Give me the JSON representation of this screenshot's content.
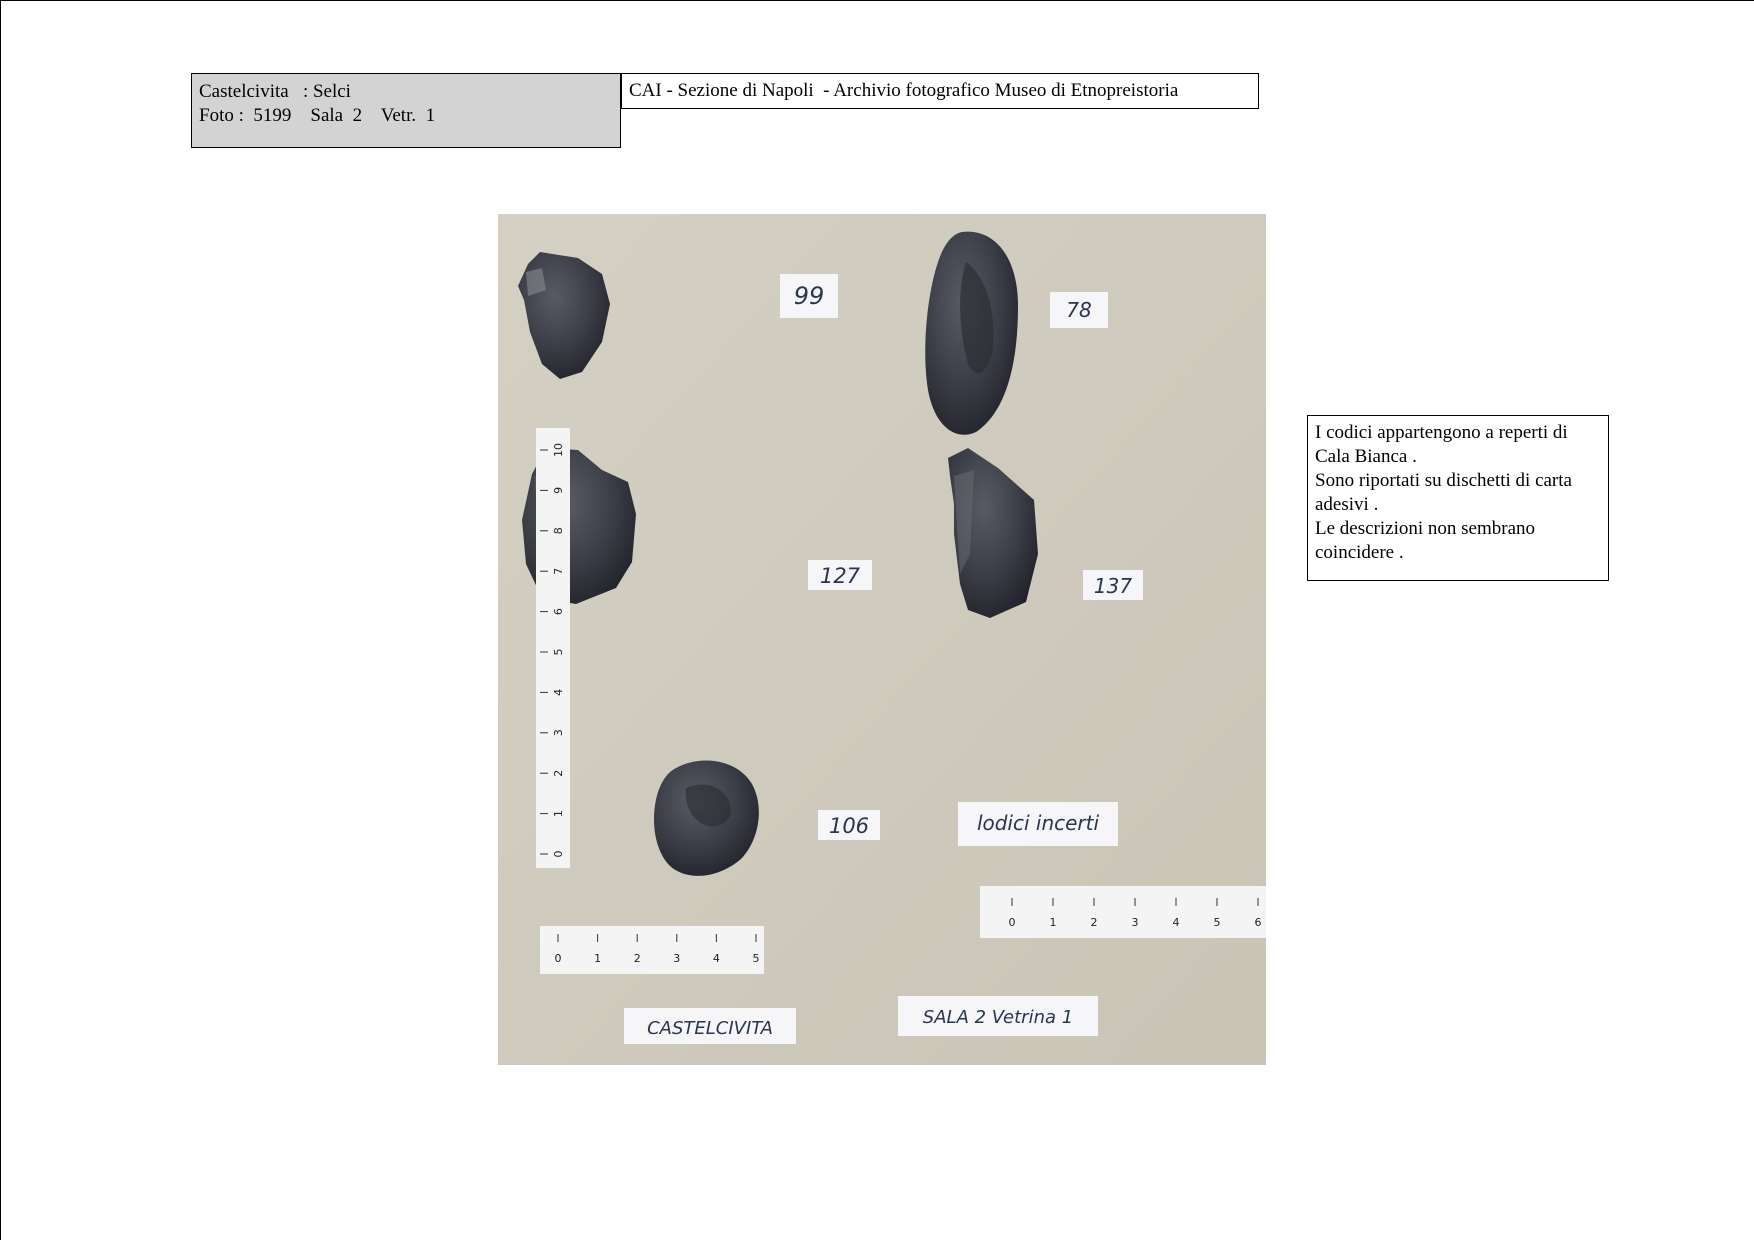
{
  "info": {
    "line1": "Castelcivita   : Selci",
    "line2": "Foto :  5199    Sala  2    Vetr.  1"
  },
  "header": {
    "title": "CAI - Sezione di Napoli  - Archivio fotografico Museo di Etnopreistoria"
  },
  "note": {
    "lines": [
      "I codici appartengono a reperti di",
      "Cala Bianca .",
      "Sono riportati su dischetti di carta",
      "adesivi .",
      "Le descrizioni non sembrano",
      "coincidere ."
    ]
  },
  "photo": {
    "labels": {
      "l99": "99",
      "l78": "78",
      "l127": "127",
      "l137": "137",
      "l106": "106",
      "codici": "lodici incerti",
      "site": "CASTELCIVITA",
      "sala": "SALA 2  Vetrina 1"
    },
    "ruler_vertical": [
      "0",
      "1",
      "2",
      "3",
      "4",
      "5",
      "6",
      "7",
      "8",
      "9",
      "10"
    ],
    "ruler_bottom_left": [
      "0",
      "1",
      "2",
      "3",
      "4",
      "5"
    ],
    "ruler_bottom_right": [
      "0",
      "1",
      "2",
      "3",
      "4",
      "5",
      "6"
    ],
    "colors": {
      "background": "#cfcabd",
      "stone": "#3d3f47",
      "label_paper": "#f6f6f8"
    }
  }
}
